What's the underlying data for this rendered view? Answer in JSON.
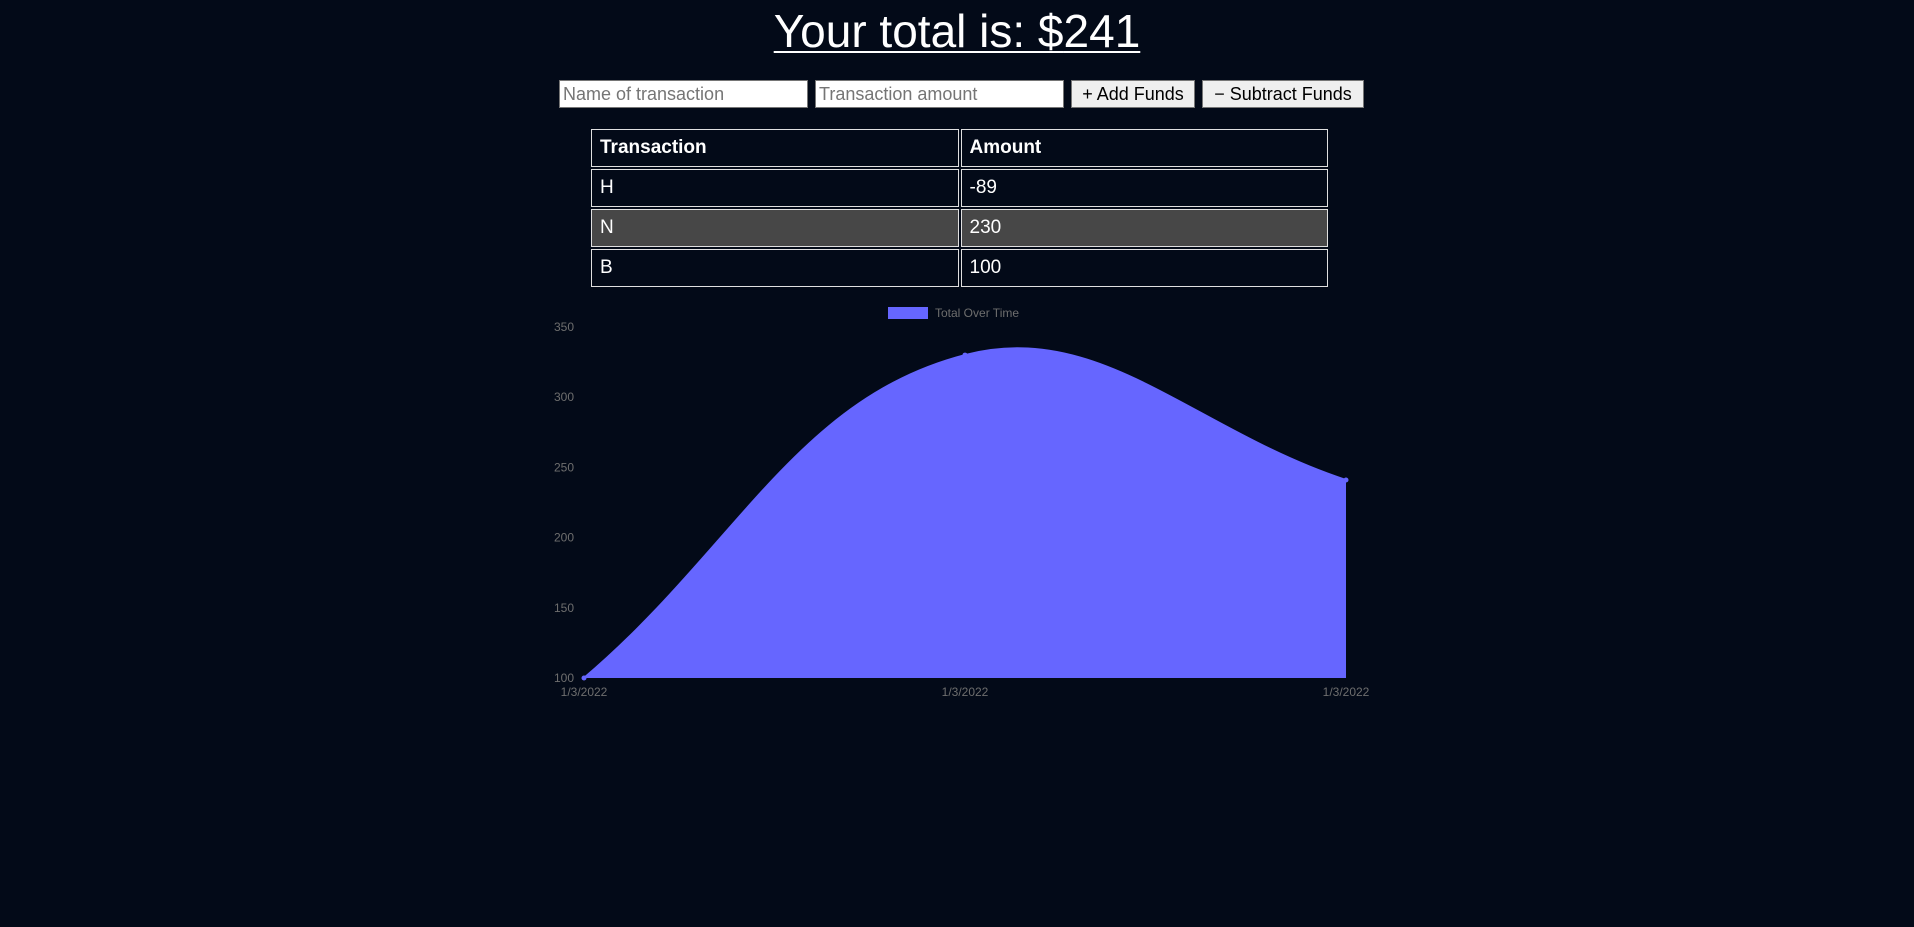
{
  "header": {
    "total_label": "Your total is: $",
    "total_value": "241"
  },
  "form": {
    "name_placeholder": "Name of transaction",
    "amount_placeholder": "Transaction amount",
    "add_label": "+ Add Funds",
    "subtract_label": "− Subtract Funds"
  },
  "table": {
    "headers": [
      "Transaction",
      "Amount"
    ],
    "rows": [
      {
        "name": "H",
        "amount": "-89"
      },
      {
        "name": "N",
        "amount": "230"
      },
      {
        "name": "B",
        "amount": "100"
      }
    ]
  },
  "chart_data": {
    "type": "area",
    "title": "",
    "legend": "top",
    "grid": false,
    "x": [
      "1/3/2022",
      "1/3/2022",
      "1/3/2022"
    ],
    "series": [
      {
        "name": "Total Over Time",
        "values": [
          100,
          330,
          241
        ],
        "color": "#6666ff"
      }
    ],
    "ylim": [
      100,
      350
    ],
    "yticks": [
      100,
      150,
      200,
      250,
      300,
      350
    ]
  },
  "colors": {
    "background": "#030a18",
    "area_fill": "#6666ff",
    "alt_row": "#474747"
  }
}
